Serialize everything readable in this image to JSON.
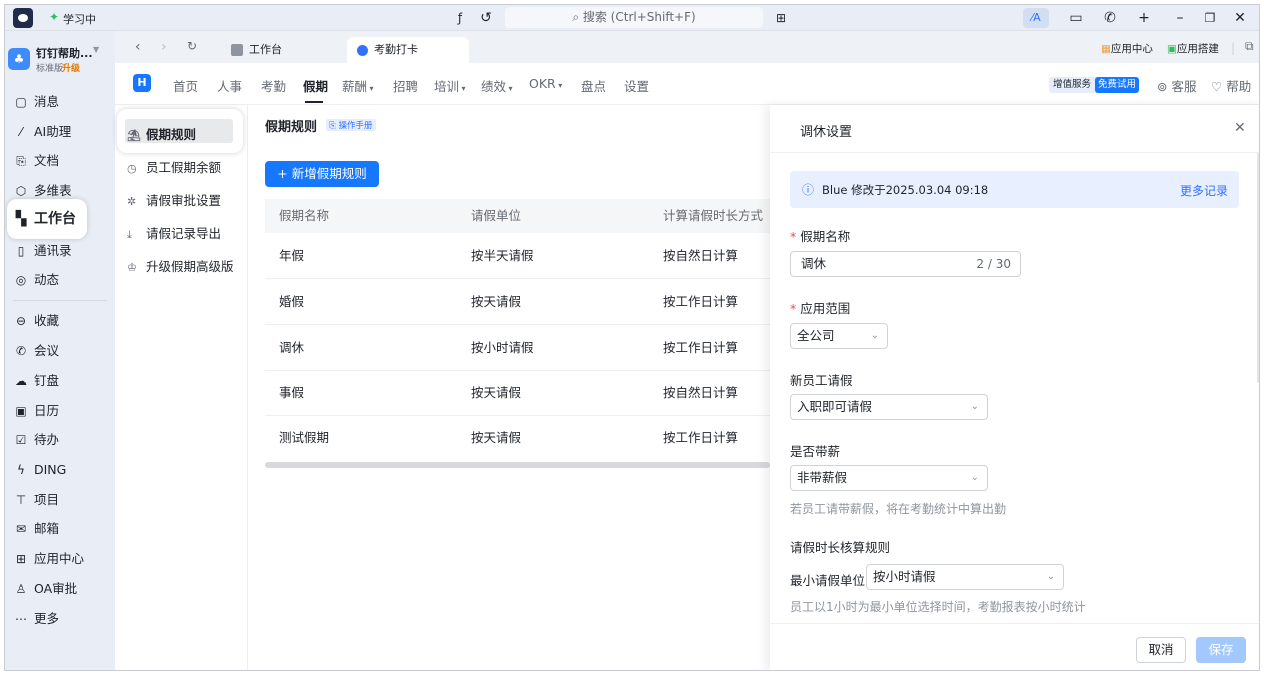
{
  "titlebar": {
    "status": "学习中",
    "search_placeholder": "搜索 (Ctrl+Shift+F)"
  },
  "org": {
    "name": "钉钉帮助...",
    "edition": "标准版",
    "upgrade": "升级"
  },
  "sidebar": {
    "items": [
      {
        "label": "消息",
        "icon": "message-icon"
      },
      {
        "label": "AI助理",
        "icon": "ai-icon"
      },
      {
        "label": "文档",
        "icon": "document-icon"
      },
      {
        "label": "多维表",
        "icon": "table-icon"
      },
      {
        "label": "工作台",
        "icon": "workbench-icon"
      },
      {
        "label": "通讯录",
        "icon": "contacts-icon"
      },
      {
        "label": "动态",
        "icon": "activity-icon"
      },
      {
        "label": "收藏",
        "icon": "favorite-icon"
      },
      {
        "label": "会议",
        "icon": "meeting-icon"
      },
      {
        "label": "钉盘",
        "icon": "cloud-icon"
      },
      {
        "label": "日历",
        "icon": "calendar-icon"
      },
      {
        "label": "待办",
        "icon": "todo-icon"
      },
      {
        "label": "DING",
        "icon": "ding-icon"
      },
      {
        "label": "项目",
        "icon": "project-icon"
      },
      {
        "label": "邮箱",
        "icon": "mail-icon"
      },
      {
        "label": "应用中心",
        "icon": "app-center-icon"
      },
      {
        "label": "OA审批",
        "icon": "approval-icon"
      },
      {
        "label": "更多",
        "icon": "more-icon"
      }
    ]
  },
  "tabs": [
    {
      "label": "工作台"
    },
    {
      "label": "考勤打卡"
    }
  ],
  "tabbar_right": {
    "app_center": "应用中心",
    "app_builder": "应用搭建"
  },
  "app_nav": {
    "items": [
      "首页",
      "人事",
      "考勤",
      "假期",
      "薪酬",
      "招聘",
      "培训",
      "绩效",
      "OKR",
      "盘点",
      "设置"
    ]
  },
  "header_right": {
    "value_service": "增值服务",
    "free_trial": "免费试用",
    "support": "客服",
    "help": "帮助"
  },
  "submenu": {
    "items": [
      "假期规则",
      "员工假期余额",
      "请假审批设置",
      "请假记录导出",
      "升级假期高级版"
    ]
  },
  "main": {
    "title": "假期规则",
    "manual": "操作手册",
    "add_button": "新增假期规则",
    "columns": [
      "假期名称",
      "请假单位",
      "计算请假时长方式"
    ],
    "rows": [
      [
        "年假",
        "按半天请假",
        "按自然日计算"
      ],
      [
        "婚假",
        "按天请假",
        "按工作日计算"
      ],
      [
        "调休",
        "按小时请假",
        "按工作日计算"
      ],
      [
        "事假",
        "按天请假",
        "按自然日计算"
      ],
      [
        "测试假期",
        "按天请假",
        "按工作日计算"
      ]
    ]
  },
  "drawer": {
    "title": "调休设置",
    "info": "Blue 修改于2025.03.04 09:18",
    "more_records": "更多记录",
    "name_label": "假期名称",
    "name_value": "调休",
    "name_count": "2 / 30",
    "scope_label": "应用范围",
    "scope_value": "全公司",
    "new_emp_label": "新员工请假",
    "new_emp_value": "入职即可请假",
    "paid_label": "是否带薪",
    "paid_value": "非带薪假",
    "paid_hint": "若员工请带薪假，将在考勤统计中算出勤",
    "rule_section": "请假时长核算规则",
    "min_unit_label": "最小请假单位",
    "min_unit_value": "按小时请假",
    "min_unit_hint": "员工以1小时为最小单位选择时间，考勤报表按小时统计",
    "cancel": "取消",
    "save": "保存"
  },
  "colors": {
    "accent": "#1677ff",
    "accent_disabled": "#a3c8fb",
    "brand": "#3370ff"
  }
}
